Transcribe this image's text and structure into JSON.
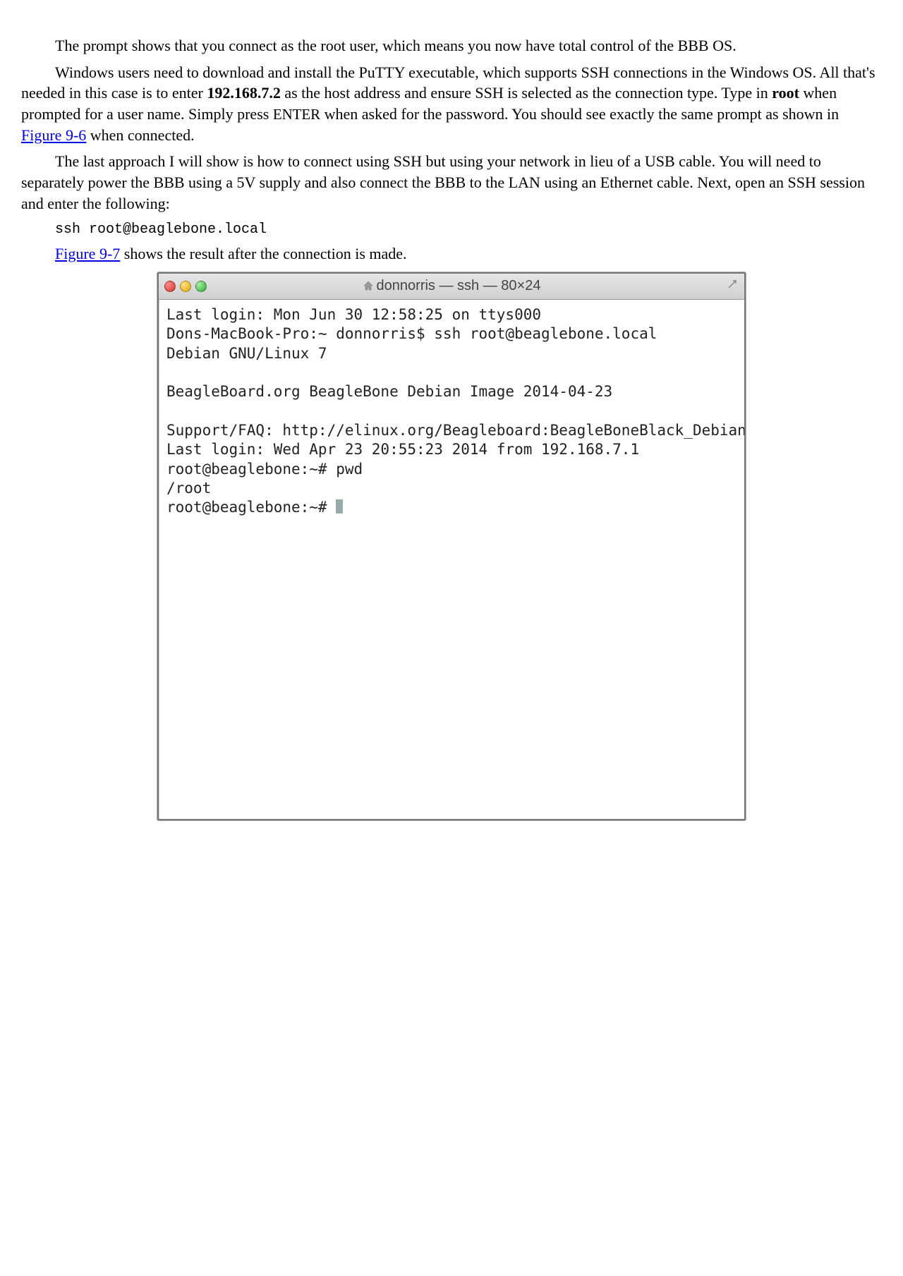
{
  "paragraphs": {
    "p1": "The prompt shows that you connect as the root user, which means you now have total control of the BBB OS.",
    "p2a": "Windows users need to download and install the PuTTY executable, which supports SSH connections in the Windows OS. All that's needed in this case is to enter ",
    "p2_ip": "192.168.7.2",
    "p2b": " as the host address and ensure SSH is selected as the connection type. Type in ",
    "p2_root": "root",
    "p2c": " when prompted for a user name. Simply press ",
    "p2_enter": "ENTER",
    "p2d": " when asked for the password. You should see exactly the same prompt as shown in ",
    "p2_link": "Figure 9-6",
    "p2e": " when connected.",
    "p3": "The last approach I will show is how to connect using SSH but using your network in lieu of a USB cable. You will need to separately power the BBB using a 5V supply and also connect the BBB to the LAN using an Ethernet cable. Next, open an SSH session and enter the following:",
    "code1": "ssh root@beaglebone.local",
    "p4_link": "Figure 9-7",
    "p4_rest": " shows the result after the connection is made."
  },
  "terminal": {
    "title": "donnorris — ssh — 80×24",
    "lines": [
      "Last login: Mon Jun 30 12:58:25 on ttys000",
      "Dons-MacBook-Pro:~ donnorris$ ssh root@beaglebone.local",
      "Debian GNU/Linux 7",
      "",
      "BeagleBoard.org BeagleBone Debian Image 2014-04-23",
      "",
      "Support/FAQ: http://elinux.org/Beagleboard:BeagleBoneBlack_Debian",
      "Last login: Wed Apr 23 20:55:23 2014 from 192.168.7.1",
      "root@beaglebone:~# pwd",
      "/root",
      "root@beaglebone:~# "
    ]
  }
}
